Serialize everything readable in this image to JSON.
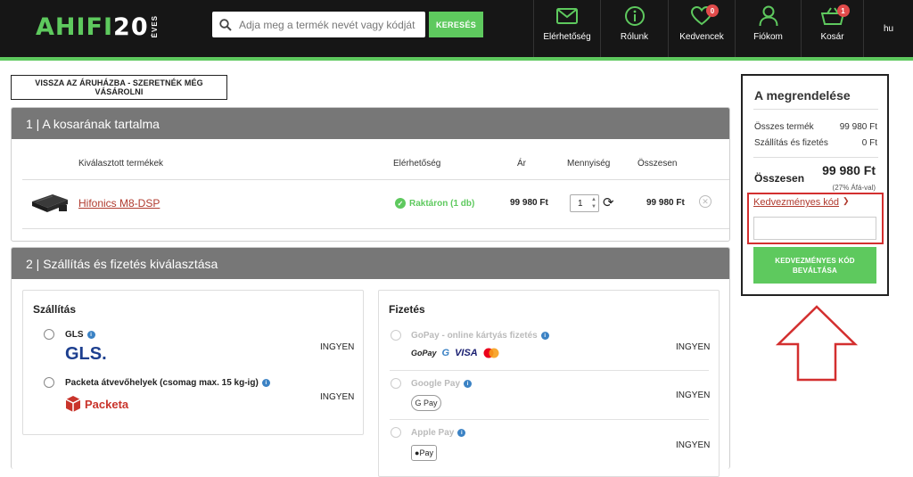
{
  "header": {
    "logo_main": "AHIFI",
    "logo_num": "20",
    "logo_sub": "ÉVES",
    "search_placeholder": "Adja meg a termék nevét vagy kódját",
    "search_button": "KERESÉS",
    "nav": [
      {
        "label": "Elérhetőség",
        "icon": "mail-icon"
      },
      {
        "label": "Rólunk",
        "icon": "info-icon"
      },
      {
        "label": "Kedvencek",
        "icon": "heart-icon",
        "badge": "0"
      },
      {
        "label": "Fiókom",
        "icon": "user-icon"
      },
      {
        "label": "Kosár",
        "icon": "basket-icon",
        "badge": "1"
      }
    ],
    "language": "hu"
  },
  "back_button": "VISSZA AZ ÁRUHÁZBA - SZERETNÉK MÉG VÁSÁROLNI",
  "cart": {
    "title": "1 | A kosarának tartalma",
    "columns": [
      "Kiválasztott termékek",
      "Elérhetőség",
      "Ár",
      "Mennyiség",
      "Összesen"
    ],
    "items": [
      {
        "name": "Hifonics M8-DSP",
        "availability": "Raktáron (1 db)",
        "price": "99 980 Ft",
        "quantity": "1",
        "total": "99 980 Ft"
      }
    ]
  },
  "shipping_payment": {
    "title": "2 | Szállítás és fizetés kiválasztása",
    "shipping": {
      "title": "Szállítás",
      "options": [
        {
          "name": "GLS",
          "price": "INGYEN",
          "logo": "GLS."
        },
        {
          "name": "Packeta átvevőhelyek (csomag max. 15 kg-ig)",
          "price": "INGYEN",
          "logo": "Packeta"
        }
      ]
    },
    "payment": {
      "title": "Fizetés",
      "options": [
        {
          "name": "GoPay - online kártyás fizetés",
          "price": "INGYEN",
          "logos": [
            "GoPay",
            "G",
            "VISA"
          ]
        },
        {
          "name": "Google Pay",
          "price": "INGYEN",
          "logo": "G Pay"
        },
        {
          "name": "Apple Pay",
          "price": "INGYEN",
          "logo": "Pay"
        }
      ]
    }
  },
  "summary": {
    "title": "A megrendelése",
    "rows": [
      {
        "label": "Összes termék",
        "value": "99 980 Ft"
      },
      {
        "label": "Szállítás és fizetés",
        "value": "0 Ft"
      }
    ],
    "total_label": "Összesen",
    "total_value": "99 980 Ft",
    "vat_note": "(27% Áfá-val)",
    "coupon_link": "Kedvezményes kód",
    "coupon_button": "KEDVEZMÉNYES KÓD BEVÁLTÁSA"
  },
  "colors": {
    "accent_green": "#5ec95e",
    "header_bg": "#161616",
    "highlight_red": "#d32f2f",
    "link_red": "#b03a2e"
  }
}
